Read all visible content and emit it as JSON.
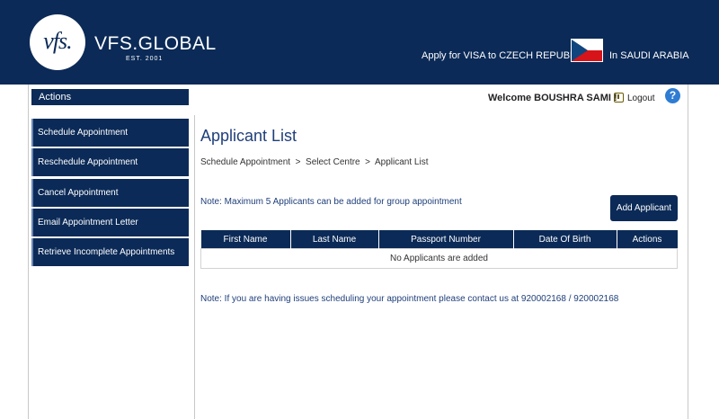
{
  "header": {
    "logo_text": "vfs.",
    "brand": "VFS.GLOBAL",
    "est": "EST. 2001",
    "apply_text": "Apply for VISA to CZECH REPUBLIC",
    "country_text": "In SAUDI ARABIA"
  },
  "sidebar": {
    "heading": "Actions",
    "items": [
      {
        "label": "Schedule Appointment"
      },
      {
        "label": "Reschedule Appointment"
      },
      {
        "label": "Cancel Appointment"
      },
      {
        "label": "Email Appointment Letter"
      },
      {
        "label": "Retrieve Incomplete Appointments"
      }
    ]
  },
  "topbar": {
    "welcome": "Welcome BOUSHRA SAMI !",
    "logout": "Logout",
    "help": "?"
  },
  "main": {
    "title": "Applicant List",
    "breadcrumb": "Schedule Appointment  >  Select Centre  >  Applicant List",
    "note_max": "Note: Maximum 5 Applicants can be added for group appointment",
    "add_button": "Add Applicant",
    "table": {
      "columns": [
        "First Name",
        "Last Name",
        "Passport Number",
        "Date Of Birth",
        "Actions"
      ],
      "empty_text": "No Applicants are added"
    },
    "note_contact": "Note: If you are having issues scheduling your appointment please contact us at 920002168 / 920002168"
  },
  "colors": {
    "primary": "#0b2a57",
    "title": "#1f3f7a",
    "help": "#2f7cd3"
  }
}
